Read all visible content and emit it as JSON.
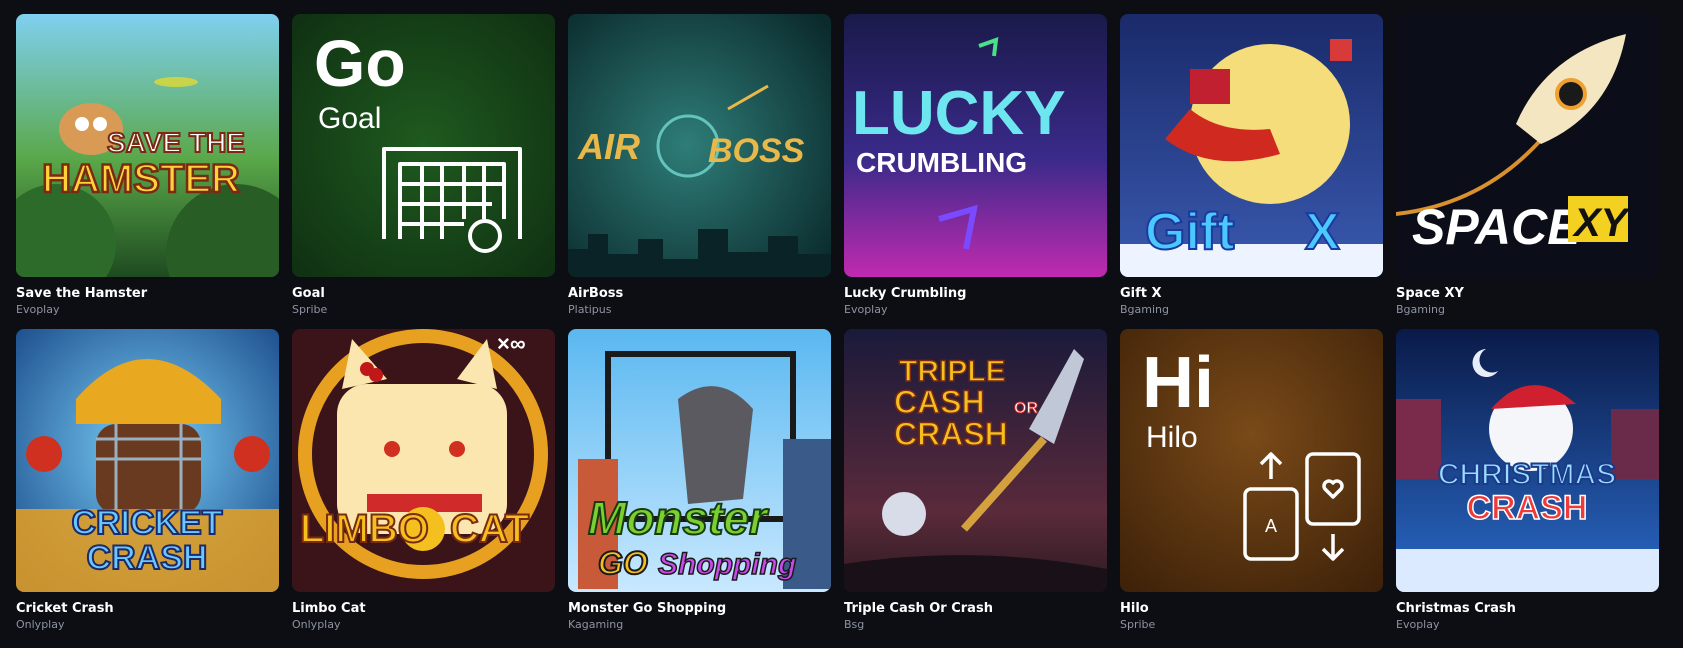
{
  "games": [
    {
      "title": "Save the Hamster",
      "provider": "Evoplay",
      "art_text": [
        "SAVE THE",
        "HAMSTER"
      ]
    },
    {
      "title": "Goal",
      "provider": "Spribe",
      "art_text": [
        "Go",
        "Goal"
      ]
    },
    {
      "title": "AirBoss",
      "provider": "Platipus",
      "art_text": [
        "AIR",
        "BOSS"
      ]
    },
    {
      "title": "Lucky Crumbling",
      "provider": "Evoplay",
      "art_text": [
        "LUCKY",
        "CRUMBLING"
      ]
    },
    {
      "title": "Gift X",
      "provider": "Bgaming",
      "art_text": [
        "Gift",
        "X"
      ]
    },
    {
      "title": "Space XY",
      "provider": "Bgaming",
      "art_text": [
        "SPACE",
        "XY"
      ]
    },
    {
      "title": "Cricket Crash",
      "provider": "Onlyplay",
      "art_text": [
        "CRICKET",
        "CRASH"
      ]
    },
    {
      "title": "Limbo Cat",
      "provider": "Onlyplay",
      "art_text": [
        "LIMBO",
        "CAT",
        "×∞"
      ]
    },
    {
      "title": "Monster Go Shopping",
      "provider": "Kagaming",
      "art_text": [
        "Monster",
        "GO",
        "Shopping"
      ]
    },
    {
      "title": "Triple Cash Or Crash",
      "provider": "Bsg",
      "art_text": [
        "TRIPLE",
        "CASH",
        "OR",
        "CRASH"
      ]
    },
    {
      "title": "Hilo",
      "provider": "Spribe",
      "art_text": [
        "Hi",
        "Hilo",
        "A"
      ]
    },
    {
      "title": "Christmas Crash",
      "provider": "Evoplay",
      "art_text": [
        "CHRISTMAS",
        "CRASH"
      ]
    }
  ],
  "colors": {
    "background": "#0c0e14",
    "provider_text": "#8e93a3"
  }
}
